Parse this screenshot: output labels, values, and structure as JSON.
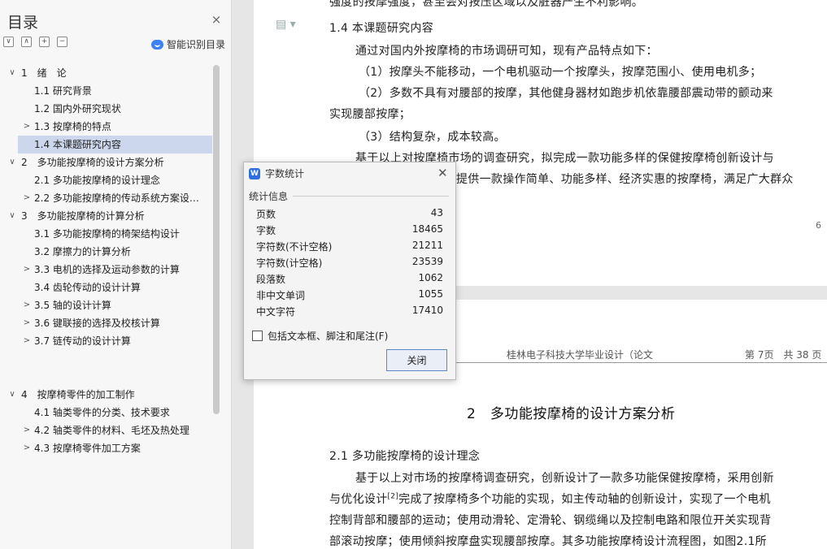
{
  "nav": {
    "title": "目录",
    "smart_toc_label": "智能识别目录",
    "tools": [
      "∨",
      "∧",
      "+",
      "−"
    ],
    "items": [
      {
        "text": "1　绪　论",
        "level": 1,
        "arrow": "∨"
      },
      {
        "text": "1.1  研究背景",
        "level": 2,
        "arrow": ""
      },
      {
        "text": "1.2  国内外研究现状",
        "level": 2,
        "arrow": ""
      },
      {
        "text": "1.3  按摩椅的特点",
        "level": 2,
        "arrow": ">"
      },
      {
        "text": "1.4  本课题研究内容",
        "level": 2,
        "arrow": "",
        "active": true
      },
      {
        "text": "2　多功能按摩椅的设计方案分析",
        "level": 1,
        "arrow": "∨"
      },
      {
        "text": "2.1  多功能按摩椅的设计理念",
        "level": 2,
        "arrow": ""
      },
      {
        "text": "2.2  多功能按摩椅的传动系统方案设…",
        "level": 2,
        "arrow": ">"
      },
      {
        "text": "3　多功能按摩椅的计算分析",
        "level": 1,
        "arrow": "∨"
      },
      {
        "text": "3.1  多功能按摩椅的椅架结构设计",
        "level": 2,
        "arrow": ""
      },
      {
        "text": "3.2  摩擦力的计算分析",
        "level": 2,
        "arrow": ""
      },
      {
        "text": "3.3  电机的选择及运动参数的计算",
        "level": 2,
        "arrow": ">"
      },
      {
        "text": "3.4  齿轮传动的设计计算",
        "level": 2,
        "arrow": ""
      },
      {
        "text": "3.5  轴的设计计算",
        "level": 2,
        "arrow": ">"
      },
      {
        "text": "3.6  键联接的选择及校核计算",
        "level": 2,
        "arrow": ">"
      },
      {
        "text": "3.7  链传动的设计计算",
        "level": 2,
        "arrow": ">"
      },
      {
        "text": "4　按摩椅零件的加工制作",
        "level": 1,
        "arrow": "∨"
      },
      {
        "text": "4.1  轴类零件的分类、技术要求",
        "level": 2,
        "arrow": ""
      },
      {
        "text": "4.2  轴类零件的材料、毛坯及热处理",
        "level": 2,
        "arrow": ">"
      },
      {
        "text": "4.3  按摩椅零件加工方案",
        "level": 2,
        "arrow": ">"
      }
    ]
  },
  "doc": {
    "page1_lines": [
      "强度的按摩强度，甚至会对按压区域以及脏器产生不利影响。",
      "1.4  本课题研究内容",
      "通过对国内外按摩椅的市场调研可知，现有产品特点如下：",
      "（1）按摩头不能移动，一个电机驱动一个按摩头，按摩范围小、使用电机多；",
      "（2）多数不具有对腰部的按摩，其他健身器材如跑步机依靠腰部震动带的颤动来",
      "实现腰部按摩；",
      "（3）结构复杂，成本较高。",
      "基于以上对按摩椅市场的调查研究，拟完成一款功能多样的保健按摩椅创新设计与",
      "提供一款操作简单、功能多样、经济实惠的按摩椅，满足广大群众"
    ],
    "page_number": "6",
    "header_title": "桂林电子科技大学毕业设计（论文",
    "header_page": "第 7页　共 38 页",
    "chapter_title": "2　多功能按摩椅的设计方案分析",
    "section_title": "2.1  多功能按摩椅的设计理念",
    "page2_lines": [
      "基于以上对市场的按摩椅调查研究，创新设计了一款多功能保健按摩椅，采用创新",
      "完成了按摩椅多个功能的实现，如主传动轴的创新设计，实现了一个电机",
      "控制背部和腰部的运动；使用动滑轮、定滑轮、钢缆绳以及控制电路和限位开关实现背",
      "部滚动按摩；使用倾斜按摩盘实现腰部按摩。其多功能按摩椅设计流程图，如图2.1所"
    ],
    "page2_line2_prefix": "与优化设计",
    "citation": "[2]"
  },
  "dialog": {
    "title": "字数统计",
    "section": "统计信息",
    "stats": [
      {
        "label": "页数",
        "value": "43"
      },
      {
        "label": "字数",
        "value": "18465"
      },
      {
        "label": "字符数(不计空格)",
        "value": "21211"
      },
      {
        "label": "字符数(计空格)",
        "value": "23539"
      },
      {
        "label": "段落数",
        "value": "1062"
      },
      {
        "label": "非中文单词",
        "value": "1055"
      },
      {
        "label": "中文字符",
        "value": "17410"
      }
    ],
    "checkbox_label": "包括文本框、脚注和尾注(F)",
    "close_label": "关闭"
  }
}
